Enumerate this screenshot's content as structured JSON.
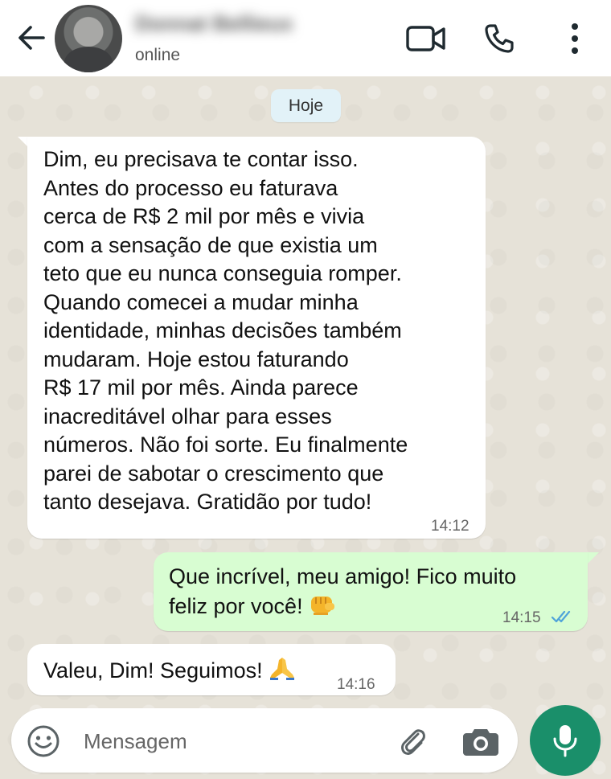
{
  "header": {
    "contact_name": "Donnat Bellieux",
    "status": "online",
    "icons": [
      "back-arrow-icon",
      "video-call-icon",
      "phone-icon",
      "more-vertical-icon"
    ]
  },
  "date_chip": "Hoje",
  "messages": [
    {
      "direction": "incoming",
      "text": "Dim, eu precisava te contar isso.\nAntes do processo eu faturava\ncerca de R$ 2 mil por mês e vivia\ncom a sensação de que existia um\nteto que eu nunca conseguia romper.\nQuando comecei a mudar minha\nidentidade, minhas decisões também\nmudaram. Hoje estou faturando\nR$ 17 mil por mês. Ainda parece\ninacreditável olhar para esses\nnúmeros. Não foi sorte. Eu finalmente\nparei de sabotar o crescimento que\ntanto desejava. Gratidão por tudo!",
      "time": "14:12"
    },
    {
      "direction": "outgoing",
      "text": "Que incrível, meu amigo! Fico muito\nfeliz por você!",
      "emoji": "fist-bump-emoji",
      "time": "14:15",
      "read_status": "read"
    },
    {
      "direction": "incoming",
      "text": "Valeu, Dim! Seguimos!",
      "emoji": "praying-hands-emoji",
      "time": "14:16"
    }
  ],
  "input": {
    "placeholder": "Mensagem",
    "value": ""
  },
  "colors": {
    "header_bg": "#ffffff",
    "chat_bg": "#e6e2d8",
    "incoming_bubble": "#ffffff",
    "outgoing_bubble": "#d8fdd2",
    "mic_button": "#1a8f6a",
    "read_ticks": "#4fa3d9",
    "date_chip": "#e2f2f8"
  }
}
